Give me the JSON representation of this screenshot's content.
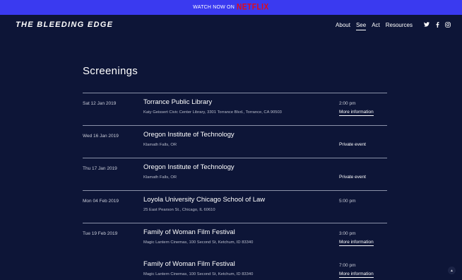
{
  "promo": {
    "text": "WATCH NOW ON",
    "brand": "NETFLIX"
  },
  "header": {
    "logo": "THE BLEEDING EDGE",
    "nav": [
      {
        "label": "About"
      },
      {
        "label": "See",
        "active": true
      },
      {
        "label": "Act"
      },
      {
        "label": "Resources"
      }
    ],
    "social": [
      "twitter-icon",
      "facebook-icon",
      "instagram-icon"
    ]
  },
  "page": {
    "title": "Screenings"
  },
  "screenings": [
    {
      "date": "Sat 12 Jan 2019",
      "venue": "Torrance Public Library",
      "address": "Katy Geissert Civic Center Library, 3301 Torrance Blvd., Torrance, CA 90503",
      "time": "2:00 pm",
      "link": "More information"
    },
    {
      "date": "Wed 16 Jan 2019",
      "venue": "Oregon Institute of Technology",
      "address": "Klamath Falls, OR",
      "status": "Private event"
    },
    {
      "date": "Thu 17 Jan 2019",
      "venue": "Oregon Institute of Technology",
      "address": "Klamath Falls, OR",
      "status": "Private event"
    },
    {
      "date": "Mon 04 Feb 2019",
      "venue": "Loyola University Chicago School of Law",
      "address": "25 East Pearson St., Chicago, IL 60610",
      "time": "5:00 pm"
    },
    {
      "date": "Tue 19 Feb 2019",
      "venue": "Family of Woman Film Festival",
      "address": "Magic Lantern Cinemas, 100 Second St, Ketchum, ID 83340",
      "time": "3:00 pm",
      "link": "More information"
    },
    {
      "date": "",
      "venue": "Family of Woman Film Festival",
      "address": "Magic Lantern Cinemas, 100 Second St, Ketchum, ID 83340",
      "time": "7:00 pm",
      "link": "More information"
    }
  ],
  "scroll_top_icon": "chevron-up-icon"
}
